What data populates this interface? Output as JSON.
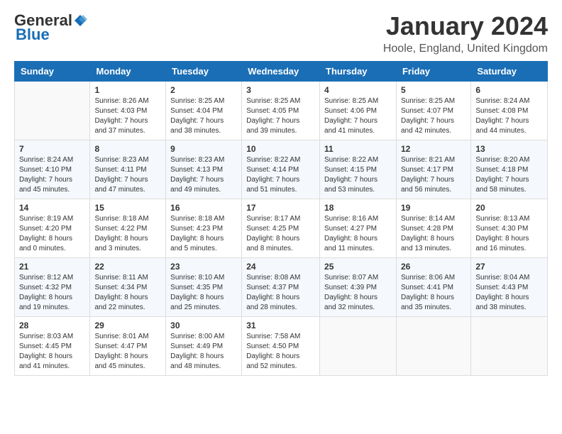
{
  "header": {
    "logo_general": "General",
    "logo_blue": "Blue",
    "month_title": "January 2024",
    "location": "Hoole, England, United Kingdom"
  },
  "days_of_week": [
    "Sunday",
    "Monday",
    "Tuesday",
    "Wednesday",
    "Thursday",
    "Friday",
    "Saturday"
  ],
  "weeks": [
    [
      {
        "day": "",
        "info": ""
      },
      {
        "day": "1",
        "info": "Sunrise: 8:26 AM\nSunset: 4:03 PM\nDaylight: 7 hours\nand 37 minutes."
      },
      {
        "day": "2",
        "info": "Sunrise: 8:25 AM\nSunset: 4:04 PM\nDaylight: 7 hours\nand 38 minutes."
      },
      {
        "day": "3",
        "info": "Sunrise: 8:25 AM\nSunset: 4:05 PM\nDaylight: 7 hours\nand 39 minutes."
      },
      {
        "day": "4",
        "info": "Sunrise: 8:25 AM\nSunset: 4:06 PM\nDaylight: 7 hours\nand 41 minutes."
      },
      {
        "day": "5",
        "info": "Sunrise: 8:25 AM\nSunset: 4:07 PM\nDaylight: 7 hours\nand 42 minutes."
      },
      {
        "day": "6",
        "info": "Sunrise: 8:24 AM\nSunset: 4:08 PM\nDaylight: 7 hours\nand 44 minutes."
      }
    ],
    [
      {
        "day": "7",
        "info": "Sunrise: 8:24 AM\nSunset: 4:10 PM\nDaylight: 7 hours\nand 45 minutes."
      },
      {
        "day": "8",
        "info": "Sunrise: 8:23 AM\nSunset: 4:11 PM\nDaylight: 7 hours\nand 47 minutes."
      },
      {
        "day": "9",
        "info": "Sunrise: 8:23 AM\nSunset: 4:13 PM\nDaylight: 7 hours\nand 49 minutes."
      },
      {
        "day": "10",
        "info": "Sunrise: 8:22 AM\nSunset: 4:14 PM\nDaylight: 7 hours\nand 51 minutes."
      },
      {
        "day": "11",
        "info": "Sunrise: 8:22 AM\nSunset: 4:15 PM\nDaylight: 7 hours\nand 53 minutes."
      },
      {
        "day": "12",
        "info": "Sunrise: 8:21 AM\nSunset: 4:17 PM\nDaylight: 7 hours\nand 56 minutes."
      },
      {
        "day": "13",
        "info": "Sunrise: 8:20 AM\nSunset: 4:18 PM\nDaylight: 7 hours\nand 58 minutes."
      }
    ],
    [
      {
        "day": "14",
        "info": "Sunrise: 8:19 AM\nSunset: 4:20 PM\nDaylight: 8 hours\nand 0 minutes."
      },
      {
        "day": "15",
        "info": "Sunrise: 8:18 AM\nSunset: 4:22 PM\nDaylight: 8 hours\nand 3 minutes."
      },
      {
        "day": "16",
        "info": "Sunrise: 8:18 AM\nSunset: 4:23 PM\nDaylight: 8 hours\nand 5 minutes."
      },
      {
        "day": "17",
        "info": "Sunrise: 8:17 AM\nSunset: 4:25 PM\nDaylight: 8 hours\nand 8 minutes."
      },
      {
        "day": "18",
        "info": "Sunrise: 8:16 AM\nSunset: 4:27 PM\nDaylight: 8 hours\nand 11 minutes."
      },
      {
        "day": "19",
        "info": "Sunrise: 8:14 AM\nSunset: 4:28 PM\nDaylight: 8 hours\nand 13 minutes."
      },
      {
        "day": "20",
        "info": "Sunrise: 8:13 AM\nSunset: 4:30 PM\nDaylight: 8 hours\nand 16 minutes."
      }
    ],
    [
      {
        "day": "21",
        "info": "Sunrise: 8:12 AM\nSunset: 4:32 PM\nDaylight: 8 hours\nand 19 minutes."
      },
      {
        "day": "22",
        "info": "Sunrise: 8:11 AM\nSunset: 4:34 PM\nDaylight: 8 hours\nand 22 minutes."
      },
      {
        "day": "23",
        "info": "Sunrise: 8:10 AM\nSunset: 4:35 PM\nDaylight: 8 hours\nand 25 minutes."
      },
      {
        "day": "24",
        "info": "Sunrise: 8:08 AM\nSunset: 4:37 PM\nDaylight: 8 hours\nand 28 minutes."
      },
      {
        "day": "25",
        "info": "Sunrise: 8:07 AM\nSunset: 4:39 PM\nDaylight: 8 hours\nand 32 minutes."
      },
      {
        "day": "26",
        "info": "Sunrise: 8:06 AM\nSunset: 4:41 PM\nDaylight: 8 hours\nand 35 minutes."
      },
      {
        "day": "27",
        "info": "Sunrise: 8:04 AM\nSunset: 4:43 PM\nDaylight: 8 hours\nand 38 minutes."
      }
    ],
    [
      {
        "day": "28",
        "info": "Sunrise: 8:03 AM\nSunset: 4:45 PM\nDaylight: 8 hours\nand 41 minutes."
      },
      {
        "day": "29",
        "info": "Sunrise: 8:01 AM\nSunset: 4:47 PM\nDaylight: 8 hours\nand 45 minutes."
      },
      {
        "day": "30",
        "info": "Sunrise: 8:00 AM\nSunset: 4:49 PM\nDaylight: 8 hours\nand 48 minutes."
      },
      {
        "day": "31",
        "info": "Sunrise: 7:58 AM\nSunset: 4:50 PM\nDaylight: 8 hours\nand 52 minutes."
      },
      {
        "day": "",
        "info": ""
      },
      {
        "day": "",
        "info": ""
      },
      {
        "day": "",
        "info": ""
      }
    ]
  ]
}
